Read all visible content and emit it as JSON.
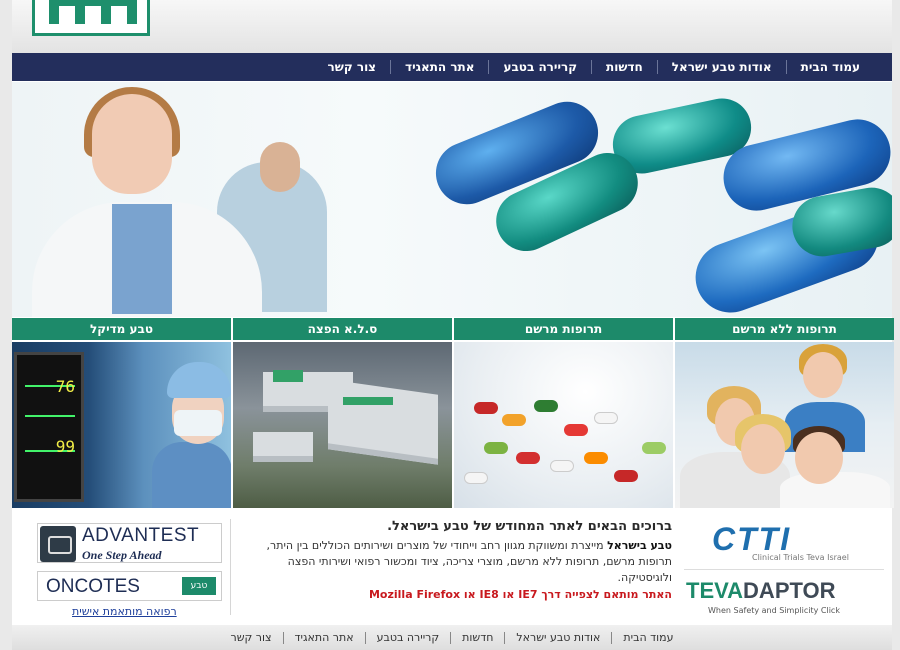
{
  "nav": {
    "items": [
      "עמוד הבית",
      "אודות טבע ישראל",
      "חדשות",
      "קריירה בטבע",
      "אתר התאגיד",
      "צור קשר"
    ]
  },
  "categories": [
    {
      "label": "תרופות ללא מרשם",
      "image": "family-photo"
    },
    {
      "label": "תרופות מרשם",
      "image": "pills-photo"
    },
    {
      "label": "ס.ל.א הפצה",
      "image": "distribution-building-photo"
    },
    {
      "label": "טבע מדיקל",
      "image": "medical-surgeon-photo"
    }
  ],
  "welcome": {
    "title": "ברוכים הבאים לאתר המחודש של טבע בישראל.",
    "brand": "טבע בישראל",
    "body": " מייצרת ומשווקת מגוון רחב וייחודי של מוצרים ושירותים הכוללים בין היתר, תרופות מרשם, תרופות ללא מרשם, מוצרי צריכה, ציוד ומכשור רפואי ושירותי הפצה ולוגיסטיקה.",
    "browser_note": "האתר מותאם לצפייה דרך IE7 או IE8 או Mozilla Firefox"
  },
  "partners": {
    "advantest_title": "ADVANTEST",
    "advantest_sub": "One Step Ahead",
    "oncotest_title": "ONCOTES",
    "oncotest_brand": "טבע",
    "oncotest_link": "רפואה מותאמת אישית",
    "ctti_title": "CTTI",
    "ctti_sub": "Clinical Trials Teva Israel",
    "tevadaptor_a": "TEVA",
    "tevadaptor_b": "DAPTOR",
    "tevadaptor_sub": "When Safety and Simplicity Click"
  },
  "footer": {
    "items": [
      "עמוד הבית",
      "אודות טבע ישראל",
      "חדשות",
      "קריירה בטבע",
      "אתר התאגיד",
      "צור קשר"
    ]
  },
  "colors": {
    "nav_bg": "#232e5c",
    "accent_green": "#1d8a6a",
    "notice_red": "#c8191e"
  }
}
